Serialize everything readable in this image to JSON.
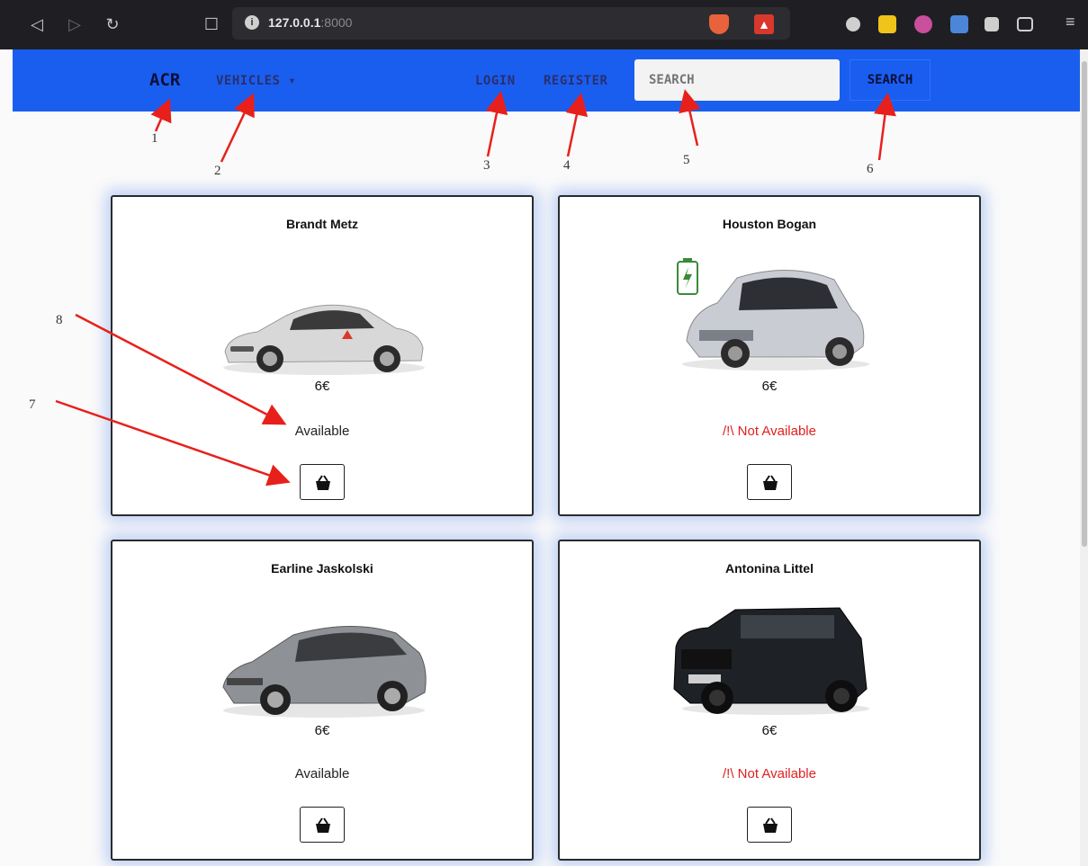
{
  "browser": {
    "url_host": "127.0.0.1",
    "url_port": ":8000"
  },
  "navbar": {
    "brand": "ACR",
    "vehicles_label": "VEHICLES ▾",
    "login_label": "LOGIN",
    "register_label": "REGISTER",
    "search_placeholder": "SEARCH",
    "search_button": "SEARCH",
    "bg_color": "#1a5ef0"
  },
  "annotations": [
    "1",
    "2",
    "3",
    "4",
    "5",
    "6",
    "7",
    "8"
  ],
  "cards": [
    {
      "title": "Brandt Metz",
      "price": "6€",
      "status": "Available",
      "available": true
    },
    {
      "title": "Houston Bogan",
      "price": "6€",
      "status": "/!\\ Not Available",
      "available": false
    },
    {
      "title": "Earline Jaskolski",
      "price": "6€",
      "status": "Available",
      "available": true
    },
    {
      "title": "Antonina Littel",
      "price": "6€",
      "status": "/!\\ Not Available",
      "available": false
    }
  ],
  "colors": {
    "unavailable": "#e02020",
    "card_glow": "#78a0f0",
    "annotation_arrow": "#e8201c"
  }
}
